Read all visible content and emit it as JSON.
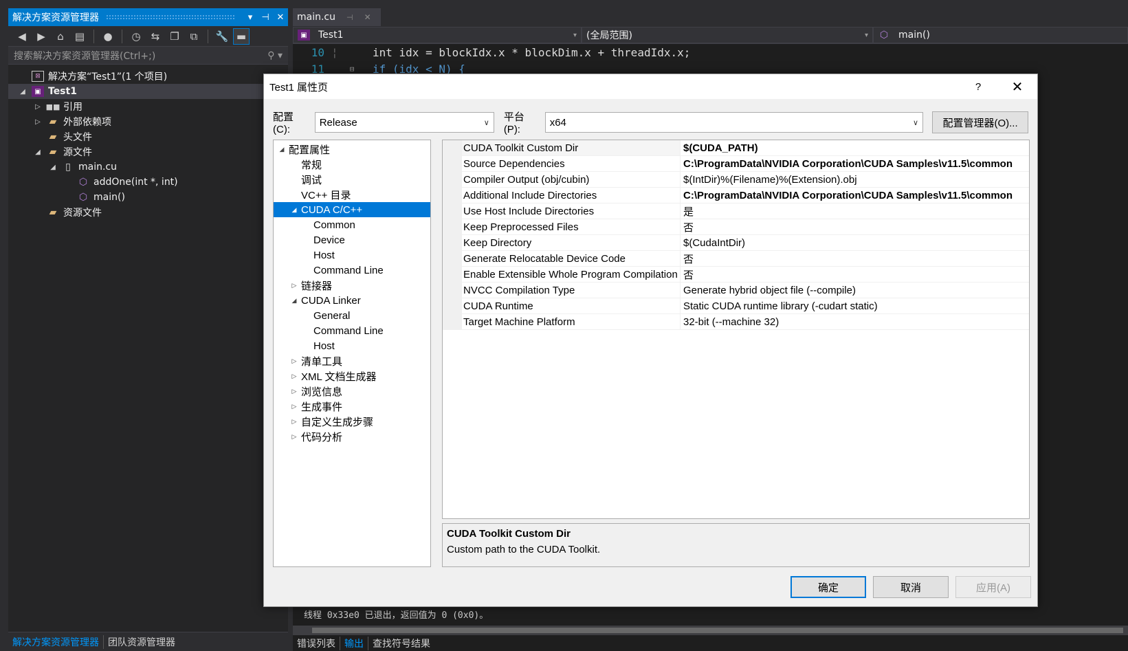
{
  "solution_explorer": {
    "title": "解决方案资源管理器",
    "title_buttons": [
      "▾",
      "⊣",
      "✕"
    ],
    "search_placeholder": "搜索解决方案资源管理器(Ctrl+;)",
    "tree": [
      {
        "label": "解决方案“Test1”(1 个项目)",
        "icon": "solution-icon",
        "level": 0,
        "arrow": "",
        "selected": false
      },
      {
        "label": "Test1",
        "icon": "project-icon",
        "level": 0,
        "arrow": "◢",
        "selected": true
      },
      {
        "label": "引用",
        "icon": "references-icon",
        "level": 1,
        "arrow": "▷",
        "selected": false
      },
      {
        "label": "外部依赖项",
        "icon": "folder-icon",
        "level": 1,
        "arrow": "▷",
        "selected": false
      },
      {
        "label": "头文件",
        "icon": "folder-icon",
        "level": 1,
        "arrow": "",
        "selected": false
      },
      {
        "label": "源文件",
        "icon": "folder-icon",
        "level": 1,
        "arrow": "◢",
        "selected": false
      },
      {
        "label": "main.cu",
        "icon": "file-icon",
        "level": 2,
        "arrow": "◢",
        "selected": false
      },
      {
        "label": "addOne(int *, int)",
        "icon": "function-icon",
        "level": 3,
        "arrow": "",
        "selected": false
      },
      {
        "label": "main()",
        "icon": "function-icon",
        "level": 3,
        "arrow": "",
        "selected": false
      },
      {
        "label": "资源文件",
        "icon": "folder-icon",
        "level": 1,
        "arrow": "",
        "selected": false
      }
    ],
    "bottom_tabs": {
      "active": "解决方案资源管理器",
      "inactive": "团队资源管理器"
    }
  },
  "editor": {
    "tab": {
      "label": "main.cu"
    },
    "nav": {
      "project": "Test1",
      "scope": "(全局范围)",
      "member": "main()"
    },
    "lines": [
      {
        "num": "10",
        "code": "int idx = blockIdx.x * blockDim.x + threadIdx.x;"
      },
      {
        "num": "11",
        "code": "if (idx < N) {"
      }
    ],
    "output_text": "线程 0x33e0 已退出，返回值为 0 (0x0)。",
    "output_tabs": [
      "错误列表",
      "输出",
      "查找符号结果"
    ],
    "output_tab_active": "输出"
  },
  "dialog": {
    "title": "Test1 属性页",
    "help": "?",
    "close": "✕",
    "config_label": "配置(C):",
    "config_value": "Release",
    "platform_label": "平台(P):",
    "platform_value": "x64",
    "config_manager": "配置管理器(O)...",
    "categories": [
      {
        "label": "配置属性",
        "indent": 0,
        "arrow": "◢",
        "selected": false
      },
      {
        "label": "常规",
        "indent": 1,
        "arrow": "",
        "selected": false
      },
      {
        "label": "调试",
        "indent": 1,
        "arrow": "",
        "selected": false
      },
      {
        "label": "VC++ 目录",
        "indent": 1,
        "arrow": "",
        "selected": false
      },
      {
        "label": "CUDA C/C++",
        "indent": 1,
        "arrow": "◢",
        "selected": true
      },
      {
        "label": "Common",
        "indent": 2,
        "arrow": "",
        "selected": false
      },
      {
        "label": "Device",
        "indent": 2,
        "arrow": "",
        "selected": false
      },
      {
        "label": "Host",
        "indent": 2,
        "arrow": "",
        "selected": false
      },
      {
        "label": "Command Line",
        "indent": 2,
        "arrow": "",
        "selected": false
      },
      {
        "label": "链接器",
        "indent": 1,
        "arrow": "▷",
        "selected": false
      },
      {
        "label": "CUDA Linker",
        "indent": 1,
        "arrow": "◢",
        "selected": false
      },
      {
        "label": "General",
        "indent": 2,
        "arrow": "",
        "selected": false
      },
      {
        "label": "Command Line",
        "indent": 2,
        "arrow": "",
        "selected": false
      },
      {
        "label": "Host",
        "indent": 2,
        "arrow": "",
        "selected": false
      },
      {
        "label": "清单工具",
        "indent": 1,
        "arrow": "▷",
        "selected": false
      },
      {
        "label": "XML 文档生成器",
        "indent": 1,
        "arrow": "▷",
        "selected": false
      },
      {
        "label": "浏览信息",
        "indent": 1,
        "arrow": "▷",
        "selected": false
      },
      {
        "label": "生成事件",
        "indent": 1,
        "arrow": "▷",
        "selected": false
      },
      {
        "label": "自定义生成步骤",
        "indent": 1,
        "arrow": "▷",
        "selected": false
      },
      {
        "label": "代码分析",
        "indent": 1,
        "arrow": "▷",
        "selected": false
      }
    ],
    "properties": [
      {
        "name": "CUDA Toolkit Custom Dir",
        "value": "$(CUDA_PATH)",
        "bold": true
      },
      {
        "name": "Source Dependencies",
        "value": "C:\\ProgramData\\NVIDIA Corporation\\CUDA Samples\\v11.5\\common",
        "bold": true
      },
      {
        "name": "Compiler Output (obj/cubin)",
        "value": "$(IntDir)%(Filename)%(Extension).obj",
        "bold": false
      },
      {
        "name": "Additional Include Directories",
        "value": "C:\\ProgramData\\NVIDIA Corporation\\CUDA Samples\\v11.5\\common",
        "bold": true
      },
      {
        "name": "Use Host Include Directories",
        "value": "是",
        "bold": false
      },
      {
        "name": "Keep Preprocessed Files",
        "value": "否",
        "bold": false
      },
      {
        "name": "Keep Directory",
        "value": "$(CudaIntDir)",
        "bold": false
      },
      {
        "name": "Generate Relocatable Device Code",
        "value": "否",
        "bold": false
      },
      {
        "name": "Enable Extensible Whole Program Compilation",
        "value": "否",
        "bold": false
      },
      {
        "name": "NVCC Compilation Type",
        "value": "Generate hybrid object file (--compile)",
        "bold": false
      },
      {
        "name": "CUDA Runtime",
        "value": "Static CUDA runtime library (-cudart static)",
        "bold": false
      },
      {
        "name": "Target Machine Platform",
        "value": "32-bit (--machine 32)",
        "bold": false
      }
    ],
    "description": {
      "title": "CUDA Toolkit Custom Dir",
      "text": "Custom path to the CUDA Toolkit."
    },
    "buttons": {
      "ok": "确定",
      "cancel": "取消",
      "apply": "应用(A)"
    }
  }
}
